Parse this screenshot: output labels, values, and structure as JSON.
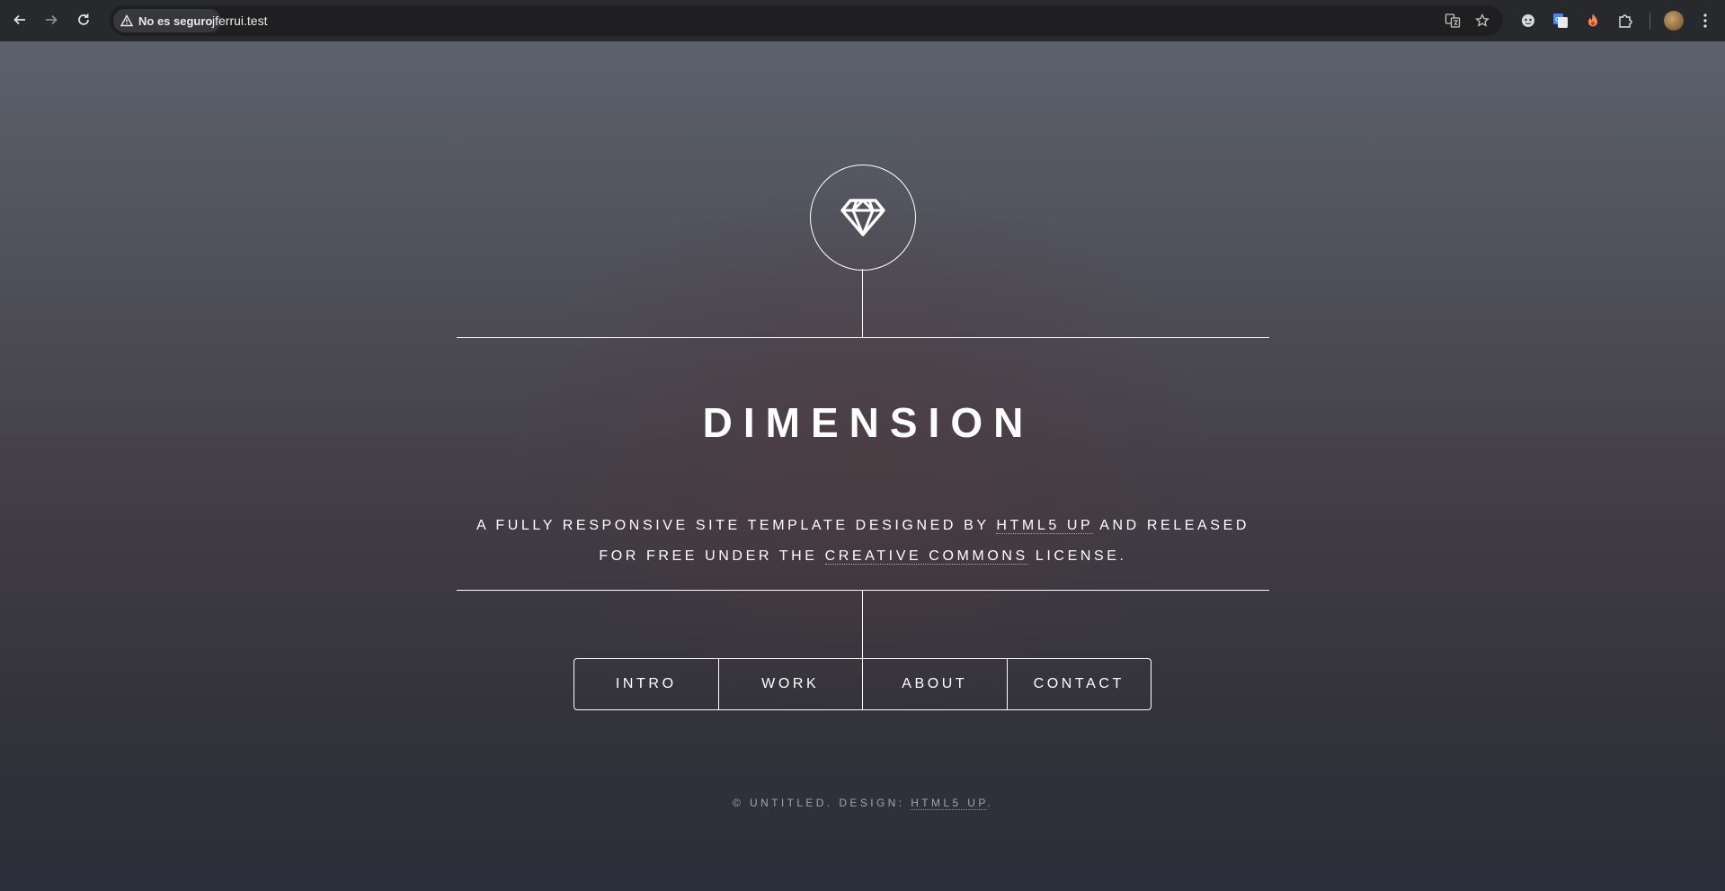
{
  "browser": {
    "security_label": "No es seguro",
    "url": "jferrui.test"
  },
  "header": {
    "logo_icon": "diamond-icon",
    "title": "DIMENSION",
    "description": {
      "part1": "A FULLY RESPONSIVE SITE TEMPLATE DESIGNED BY ",
      "link1": "HTML5 UP",
      "part2": " AND RELEASED FOR FREE UNDER THE ",
      "link2": "CREATIVE COMMONS",
      "part3": " LICENSE."
    }
  },
  "nav": {
    "items": [
      {
        "label": "INTRO"
      },
      {
        "label": "WORK"
      },
      {
        "label": "ABOUT"
      },
      {
        "label": "CONTACT"
      }
    ]
  },
  "footer": {
    "prefix": "© UNTITLED. DESIGN: ",
    "link": "HTML5 UP",
    "suffix": "."
  }
}
